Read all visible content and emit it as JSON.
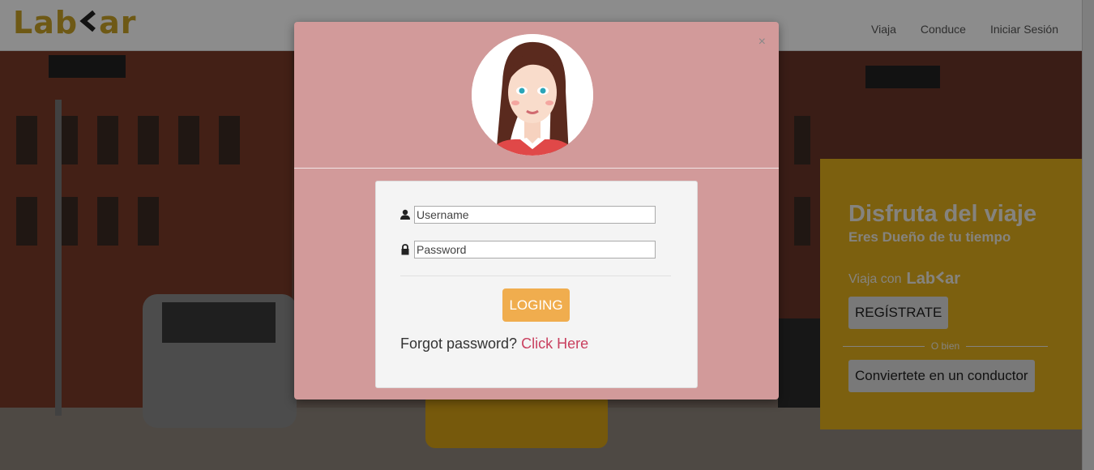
{
  "header": {
    "logo_left": "Lab",
    "logo_right": "ar",
    "nav": [
      "Viaja",
      "Conduce",
      "Iniciar Sesión"
    ]
  },
  "promo": {
    "title": "Disfruta del viaje",
    "subtitle": "Eres Dueño de tu tiempo",
    "ride_text": "Viaja con",
    "ride_logo_left": "Lab",
    "ride_logo_right": "ar",
    "register_label": "REGÍSTRATE",
    "or_text": "O bien",
    "driver_label": "Conviertete en un conductor"
  },
  "modal": {
    "close_label": "×",
    "username_placeholder": "Username",
    "password_placeholder": "Password",
    "login_label": "LOGING",
    "forgot_text": "Forgot password?",
    "forgot_link": "Click Here"
  },
  "colors": {
    "brand": "#c9a227",
    "promo_bg": "#e2b01c",
    "modal_bg": "#d29a9a",
    "login_btn": "#f0ad4e",
    "link": "#c9405f"
  },
  "icons": [
    "user-icon",
    "lock-icon",
    "avatar-illustration"
  ]
}
